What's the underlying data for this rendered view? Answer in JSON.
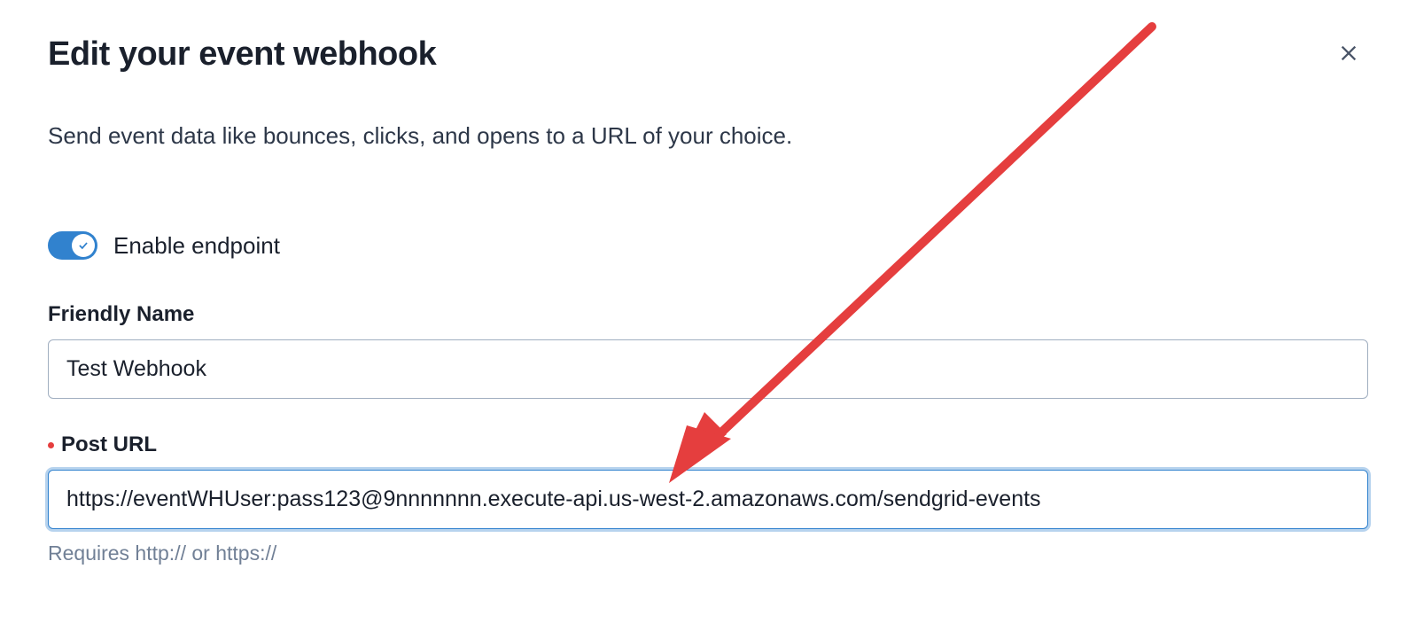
{
  "modal": {
    "title": "Edit your event webhook",
    "description": "Send event data like bounces, clicks, and opens to a URL of your choice."
  },
  "toggle": {
    "label": "Enable endpoint",
    "enabled": true
  },
  "fields": {
    "friendly_name": {
      "label": "Friendly Name",
      "value": "Test Webhook"
    },
    "post_url": {
      "label": "Post URL",
      "value": "https://eventWHUser:pass123@9nnnnnnn.execute-api.us-west-2.amazonaws.com/sendgrid-events",
      "helper": "Requires http:// or https://",
      "required": true
    }
  }
}
